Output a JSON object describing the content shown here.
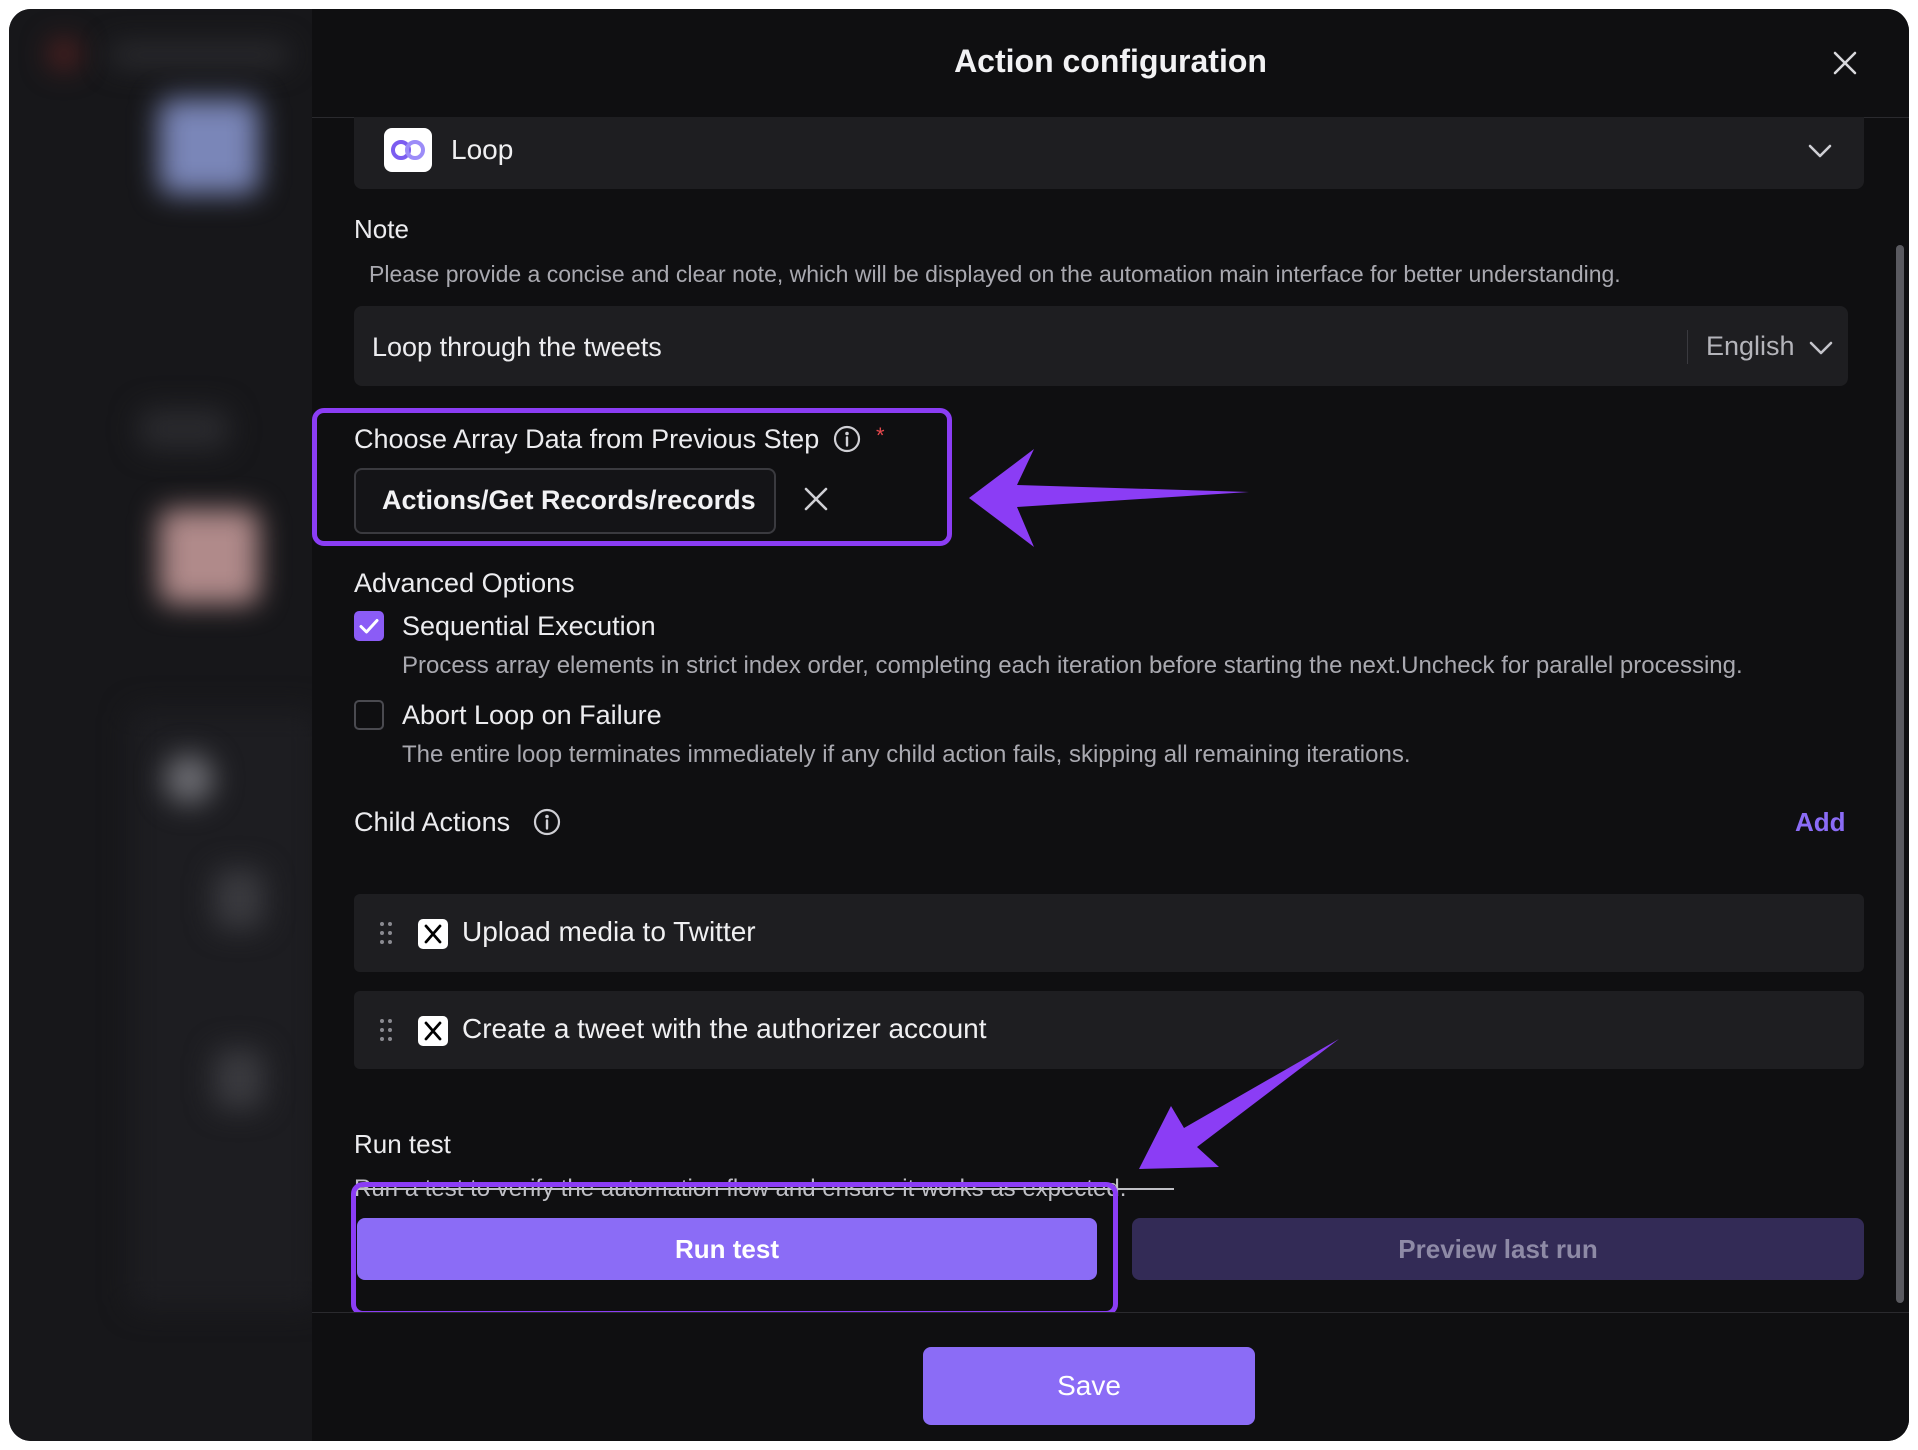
{
  "header": {
    "title": "Action configuration"
  },
  "action_select": {
    "label": "Loop",
    "icon": "loop-icon"
  },
  "note": {
    "label": "Note",
    "help": "Please provide a concise and clear note, which will be displayed on the automation main interface for better understanding.",
    "value": "Loop through the tweets",
    "language": "English"
  },
  "array_data": {
    "label": "Choose Array Data from Previous Step",
    "required_mark": "*",
    "value": "Actions/Get Records/records"
  },
  "advanced": {
    "label": "Advanced Options",
    "options": [
      {
        "label": "Sequential Execution",
        "checked": true,
        "description": "Process array elements in strict index order, completing each iteration before starting the next.Uncheck for parallel processing."
      },
      {
        "label": "Abort Loop on Failure",
        "checked": false,
        "description": "The entire loop terminates immediately if any child action fails, skipping all remaining iterations."
      }
    ]
  },
  "child_actions": {
    "label": "Child Actions",
    "add_label": "Add",
    "items": [
      {
        "label": "Upload media to Twitter",
        "icon": "x-logo-icon"
      },
      {
        "label": "Create a tweet with the authorizer account",
        "icon": "x-logo-icon"
      }
    ]
  },
  "run_test": {
    "label": "Run test",
    "help": "Run a test to verify the automation flow and ensure it works as expected.",
    "run_button": "Run test",
    "preview_button": "Preview last run"
  },
  "footer": {
    "save_label": "Save"
  },
  "colors": {
    "accent": "#8b6cf6",
    "annotation": "#8b3df5",
    "panel_bg": "#0f0f11",
    "field_bg": "#1e1e21",
    "checkbox_checked": "#8b5cf6",
    "required": "#e5484d"
  }
}
